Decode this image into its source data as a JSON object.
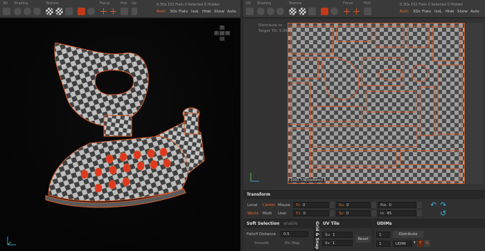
{
  "left_pane": {
    "toolbar": {
      "labels": [
        "3D",
        "Shading",
        "Texture",
        "Focus",
        "Pick",
        "Up"
      ],
      "stats": "0.3Ds 152 Flats    0 Selected    0 Hidden",
      "buttons": [
        "Both",
        "3Ds",
        "Flats",
        "IsoL",
        "Hide",
        "Show",
        "Auto"
      ],
      "active_button": "Both"
    },
    "navcube": [
      "T",
      "F",
      "R"
    ]
  },
  "right_pane": {
    "toolbar": {
      "labels": [
        "UV",
        "Shading",
        "Texture",
        "Focus",
        "Pick"
      ],
      "stats": "0.3Ds 152 Flats    0 Selected    0 Hidden",
      "buttons": [
        "Both",
        "3Ds",
        "Flats",
        "IsoL",
        "Hide",
        "Show",
        "Auto"
      ],
      "active_button": "Both"
    },
    "uv_view": {
      "info_line1": "Distribute to",
      "info_line2": "Target TD: 5.99",
      "tile_label": "1001    T:N(conform)"
    }
  },
  "transform": {
    "title": "Transform",
    "local": "Local",
    "center": "Center",
    "mouse": "Mouse",
    "world": "World",
    "multi": "Multi",
    "user": "User",
    "tu_tag": "Tu",
    "tu_value": "0",
    "tv_tag": "Tv",
    "tv_value": "0",
    "su_tag": "Su",
    "su_value": "0",
    "sv_tag": "Sv",
    "sv_value": "0",
    "rw_tag": "Rw",
    "rw_value": "0",
    "in_tag": "In",
    "in_value": "45"
  },
  "soft_selection": {
    "title": "Soft Selection",
    "enable": "enable",
    "falloff_label": "Falloff Distance",
    "falloff_value": "0.5",
    "smooth": "Smooth",
    "pin_map": "Pin Map"
  },
  "grid_snap": {
    "label": "Grid & Snap"
  },
  "uv_tile": {
    "title": "UV Tile",
    "su_tag": "Su",
    "su_value": "1",
    "sv_tag": "Sv",
    "sv_value": "1",
    "reset": "Reset"
  },
  "udims": {
    "title": "UDIMs",
    "value1": "1",
    "distribute": "Distribute",
    "value2": "1",
    "udim": "UDIM",
    "t_btn": "T",
    "pct_btn": "%"
  },
  "colors": {
    "accent": "#e86a2a",
    "arrow": "#3ab2d6",
    "panel": "#303030"
  }
}
